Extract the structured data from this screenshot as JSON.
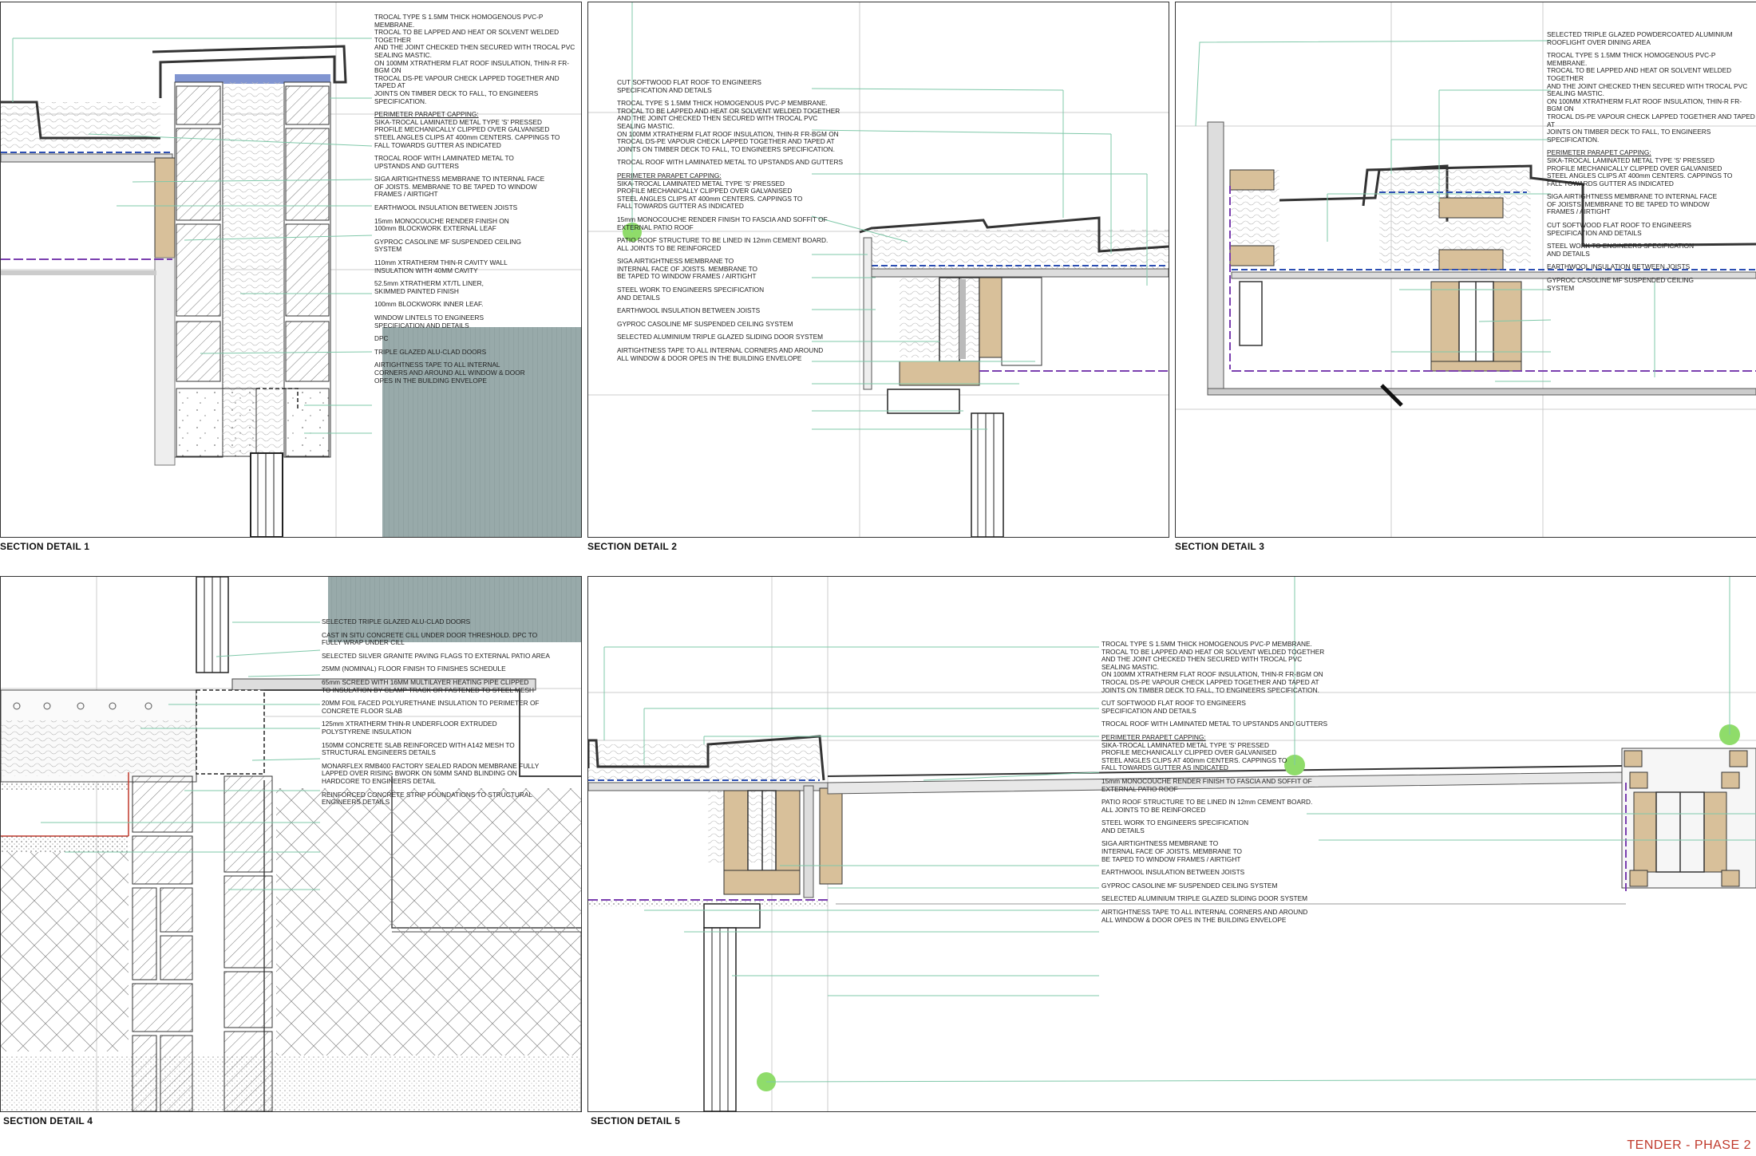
{
  "sheet": {
    "stamp": "TENDER - PHASE 2",
    "colors": {
      "annotation_line": "#7fc8a9",
      "vcl_dashed": "#7b3fb0",
      "membrane_blue": "#2d4fb3",
      "timber": "#d8c09a",
      "glazing_panel": "#98aaaa",
      "callout_dot": "#8fdc6a",
      "stamp": "#c0392b"
    }
  },
  "details": [
    {
      "caption": "SECTION DETAIL 1",
      "notes": [
        {
          "lines": [
            "TROCAL TYPE S 1.5MM THICK HOMOGENOUS PVC-P MEMBRANE.",
            "TROCAL TO BE LAPPED AND HEAT OR SOLVENT WELDED TOGETHER",
            "AND THE JOINT CHECKED THEN SECURED WITH TROCAL PVC",
            "SEALING MASTIC.",
            "ON 100MM XTRATHERM FLAT ROOF INSULATION, THIN-R FR-BGM ON",
            "TROCAL DS-PE VAPOUR CHECK LAPPED TOGETHER AND TAPED AT",
            "JOINTS ON TIMBER DECK TO FALL, TO ENGINEERS SPECIFICATION."
          ]
        },
        {
          "head": "PERIMETER PARAPET CAPPING:",
          "lines": [
            "SIKA-TROCAL LAMINATED METAL TYPE 'S' PRESSED",
            "PROFILE MECHANICALLY CLIPPED OVER GALVANISED",
            "STEEL ANGLES CLIPS AT 400mm CENTERS. CAPPINGS TO",
            "FALL TOWARDS GUTTER AS INDICATED"
          ]
        },
        {
          "lines": [
            "TROCAL ROOF WITH LAMINATED METAL TO",
            "UPSTANDS AND GUTTERS"
          ]
        },
        {
          "lines": [
            "SIGA AIRTIGHTNESS MEMBRANE TO INTERNAL FACE",
            "OF JOISTS. MEMBRANE TO BE TAPED TO WINDOW",
            "FRAMES / AIRTIGHT"
          ]
        },
        {
          "lines": [
            "EARTHWOOL INSULATION BETWEEN JOISTS"
          ]
        },
        {
          "lines": [
            "15mm MONOCOUCHE RENDER FINISH ON",
            "100mm BLOCKWORK EXTERNAL LEAF"
          ]
        },
        {
          "lines": [
            "GYPROC CASOLINE MF SUSPENDED CEILING",
            "SYSTEM"
          ]
        },
        {
          "lines": [
            "110mm XTRATHERM THIN-R CAVITY WALL",
            "INSULATION WITH 40MM CAVITY"
          ]
        },
        {
          "lines": [
            "52.5mm XTRATHERM XT/TL LINER,",
            "SKIMMED PAINTED FINISH"
          ]
        },
        {
          "lines": [
            "100mm BLOCKWORK INNER LEAF."
          ]
        },
        {
          "lines": [
            "WINDOW LINTELS TO ENGINEERS",
            "SPECIFICATION AND DETAILS"
          ]
        },
        {
          "lines": [
            "DPC"
          ]
        },
        {
          "lines": [
            "TRIPLE GLAZED ALU-CLAD DOORS"
          ]
        },
        {
          "lines": [
            "AIRTIGHTNESS TAPE TO ALL INTERNAL",
            "CORNERS AND AROUND ALL WINDOW & DOOR",
            "OPES IN THE BUILDING ENVELOPE"
          ]
        }
      ]
    },
    {
      "caption": "SECTION DETAIL 2",
      "notes": [
        {
          "lines": [
            "CUT SOFTWOOD FLAT ROOF TO ENGINEERS",
            "SPECIFICATION AND DETAILS"
          ]
        },
        {
          "lines": [
            "TROCAL TYPE S 1.5MM THICK HOMOGENOUS PVC-P MEMBRANE.",
            "TROCAL TO BE LAPPED AND HEAT OR SOLVENT WELDED TOGETHER",
            "AND THE JOINT CHECKED THEN SECURED WITH TROCAL PVC",
            "SEALING MASTIC.",
            "ON 100MM XTRATHERM FLAT ROOF INSULATION, THIN-R FR-BGM ON",
            "TROCAL DS-PE VAPOUR CHECK LAPPED TOGETHER AND TAPED AT",
            "JOINTS ON TIMBER DECK TO FALL, TO ENGINEERS SPECIFICATION."
          ]
        },
        {
          "lines": [
            "TROCAL ROOF WITH LAMINATED METAL TO UPSTANDS AND GUTTERS"
          ]
        },
        {
          "head": "PERIMETER PARAPET CAPPING:",
          "lines": [
            "SIKA-TROCAL LAMINATED METAL TYPE 'S' PRESSED",
            "PROFILE MECHANICALLY CLIPPED OVER GALVANISED",
            "STEEL ANGLES CLIPS AT 400mm CENTERS. CAPPINGS TO",
            "FALL TOWARDS GUTTER AS INDICATED"
          ]
        },
        {
          "lines": [
            "15mm MONOCOUCHE RENDER FINISH TO FASCIA AND SOFFIT OF",
            "EXTERNAL PATIO ROOF"
          ]
        },
        {
          "lines": [
            "PATIO ROOF STRUCTURE TO BE LINED IN 12mm CEMENT BOARD.",
            "ALL JOINTS TO BE REINFORCED"
          ]
        },
        {
          "lines": [
            "SIGA AIRTIGHTNESS MEMBRANE TO",
            "INTERNAL FACE OF JOISTS. MEMBRANE TO",
            "BE TAPED TO WINDOW FRAMES / AIRTIGHT"
          ]
        },
        {
          "lines": [
            "STEEL WORK TO ENGINEERS SPECIFICATION",
            "AND DETAILS"
          ]
        },
        {
          "lines": [
            "EARTHWOOL INSULATION BETWEEN JOISTS"
          ]
        },
        {
          "lines": [
            "GYPROC CASOLINE MF SUSPENDED CEILING SYSTEM"
          ]
        },
        {
          "lines": [
            "SELECTED ALUMINIUM TRIPLE GLAZED SLIDING DOOR SYSTEM"
          ]
        },
        {
          "lines": [
            "AIRTIGHTNESS TAPE TO ALL INTERNAL CORNERS AND AROUND",
            "ALL WINDOW & DOOR OPES IN THE BUILDING ENVELOPE"
          ]
        }
      ]
    },
    {
      "caption": "SECTION DETAIL 3",
      "notes": [
        {
          "lines": [
            "SELECTED TRIPLE GLAZED POWDERCOATED ALUMINIUM",
            "ROOFLIGHT OVER DINING AREA"
          ]
        },
        {
          "lines": [
            "TROCAL TYPE S 1.5MM THICK HOMOGENOUS PVC-P MEMBRANE.",
            "TROCAL TO BE LAPPED AND HEAT OR SOLVENT WELDED TOGETHER",
            "AND THE JOINT CHECKED THEN SECURED WITH TROCAL PVC",
            "SEALING MASTIC.",
            "ON 100MM XTRATHERM FLAT ROOF INSULATION, THIN-R FR-BGM ON",
            "TROCAL DS-PE VAPOUR CHECK LAPPED TOGETHER AND TAPED AT",
            "JOINTS ON TIMBER DECK TO FALL, TO ENGINEERS SPECIFICATION."
          ]
        },
        {
          "head": "PERIMETER PARAPET CAPPING:",
          "lines": [
            "SIKA-TROCAL LAMINATED METAL TYPE 'S' PRESSED",
            "PROFILE MECHANICALLY CLIPPED OVER GALVANISED",
            "STEEL ANGLES CLIPS AT 400mm CENTERS. CAPPINGS TO",
            "FALL TOWARDS GUTTER AS INDICATED"
          ]
        },
        {
          "lines": [
            "SIGA AIRTIGHTNESS MEMBRANE TO INTERNAL FACE",
            "OF JOISTS. MEMBRANE TO BE TAPED TO WINDOW",
            "FRAMES / AIRTIGHT"
          ]
        },
        {
          "lines": [
            "CUT SOFTWOOD FLAT ROOF TO ENGINEERS",
            "SPECIFICATION AND DETAILS"
          ]
        },
        {
          "lines": [
            "STEEL WORK TO ENGINEERS SPECIFICATION",
            "AND DETAILS"
          ]
        },
        {
          "lines": [
            "EARTHWOOL INSULATION BETWEEN JOISTS"
          ]
        },
        {
          "lines": [
            "GYPROC CASOLINE MF SUSPENDED CEILING",
            "SYSTEM"
          ]
        }
      ]
    },
    {
      "caption": "SECTION DETAIL 4",
      "notes": [
        {
          "lines": [
            "SELECTED TRIPLE GLAZED ALU-CLAD DOORS"
          ]
        },
        {
          "lines": [
            "CAST IN SITU CONCRETE CILL UNDER DOOR THRESHOLD. DPC TO",
            "FULLY WRAP UNDER CILL"
          ]
        },
        {
          "lines": [
            "SELECTED SILVER GRANITE PAVING FLAGS TO EXTERNAL PATIO AREA"
          ]
        },
        {
          "lines": [
            "25MM (NOMINAL) FLOOR FINISH TO FINISHES SCHEDULE"
          ]
        },
        {
          "lines": [
            "65mm SCREED WITH 16MM MULTILAYER HEATING PIPE CLIPPED",
            "TO INSULATION BY CLAMP TRACK OR FASTENED TO STEEL MESH"
          ]
        },
        {
          "lines": [
            "20MM FOIL FACED POLYURETHANE INSULATION TO PERIMETER OF",
            "CONCRETE FLOOR SLAB"
          ]
        },
        {
          "lines": [
            "125mm XTRATHERM THIN-R UNDERFLOOR EXTRUDED",
            "POLYSTYRENE INSULATION"
          ]
        },
        {
          "lines": [
            "150MM CONCRETE SLAB REINFORCED WITH A142 MESH TO",
            "STRUCTURAL ENGINEERS DETAILS"
          ]
        },
        {
          "lines": [
            "MONARFLEX RMB400 FACTORY SEALED RADON MEMBRANE FULLY",
            "LAPPED OVER RISING BWORK ON 50MM SAND BLINDING ON",
            "HARDCORE TO ENGINEERS DETAIL"
          ]
        },
        {
          "lines": [
            "REINFORCED CONCRETE STRIP FOUNDATIONS TO STRUCTURAL",
            "ENGINEERS DETAILS"
          ]
        }
      ]
    },
    {
      "caption": "SECTION DETAIL 5",
      "notes": [
        {
          "lines": [
            "TROCAL TYPE S 1.5MM THICK HOMOGENOUS PVC-P MEMBRANE.",
            "TROCAL TO BE LAPPED AND HEAT OR SOLVENT WELDED TOGETHER",
            "AND THE JOINT CHECKED THEN SECURED WITH TROCAL PVC",
            "SEALING MASTIC.",
            "ON 100MM XTRATHERM FLAT ROOF INSULATION, THIN-R FR-BGM ON",
            "TROCAL DS-PE VAPOUR CHECK LAPPED TOGETHER AND TAPED AT",
            "JOINTS ON TIMBER DECK TO FALL, TO ENGINEERS SPECIFICATION."
          ]
        },
        {
          "lines": [
            "CUT SOFTWOOD FLAT ROOF TO ENGINEERS",
            "SPECIFICATION AND DETAILS"
          ]
        },
        {
          "lines": [
            "TROCAL ROOF WITH LAMINATED METAL TO UPSTANDS AND GUTTERS"
          ]
        },
        {
          "head": "PERIMETER PARAPET CAPPING:",
          "lines": [
            "SIKA-TROCAL LAMINATED METAL TYPE 'S' PRESSED",
            "PROFILE MECHANICALLY CLIPPED OVER GALVANISED",
            "STEEL ANGLES CLIPS AT 400mm CENTERS. CAPPINGS TO",
            "FALL TOWARDS GUTTER AS INDICATED"
          ]
        },
        {
          "lines": [
            "15mm MONOCOUCHE RENDER FINISH TO FASCIA AND SOFFIT OF",
            "EXTERNAL PATIO ROOF"
          ]
        },
        {
          "lines": [
            "PATIO ROOF STRUCTURE TO BE LINED IN 12mm CEMENT BOARD.",
            "ALL JOINTS TO BE REINFORCED"
          ]
        },
        {
          "lines": [
            "STEEL WORK TO ENGINEERS SPECIFICATION",
            "AND DETAILS"
          ]
        },
        {
          "lines": [
            "SIGA AIRTIGHTNESS MEMBRANE TO",
            "INTERNAL FACE OF JOISTS. MEMBRANE TO",
            "BE TAPED TO WINDOW FRAMES / AIRTIGHT"
          ]
        },
        {
          "lines": [
            "EARTHWOOL INSULATION BETWEEN JOISTS"
          ]
        },
        {
          "lines": [
            "GYPROC CASOLINE MF SUSPENDED CEILING SYSTEM"
          ]
        },
        {
          "lines": [
            "SELECTED ALUMINIUM TRIPLE GLAZED SLIDING DOOR SYSTEM"
          ]
        },
        {
          "lines": [
            "AIRTIGHTNESS TAPE TO ALL INTERNAL CORNERS AND AROUND",
            "ALL WINDOW & DOOR OPES IN THE BUILDING ENVELOPE"
          ]
        }
      ]
    }
  ]
}
